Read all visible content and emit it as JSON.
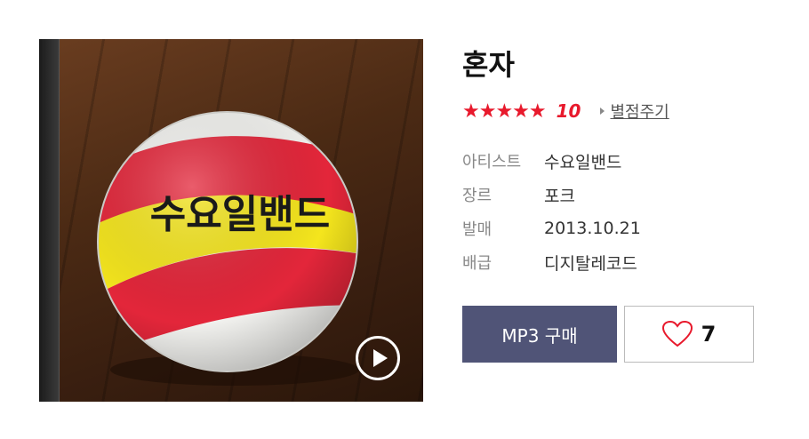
{
  "album": {
    "title": "혼자",
    "cover_text": "수요일밴드"
  },
  "rating": {
    "stars": "★★★★★",
    "score": "10",
    "rate_link": "별점주기"
  },
  "info": [
    {
      "label": "아티스트",
      "value": "수요일밴드"
    },
    {
      "label": "장르",
      "value": "포크"
    },
    {
      "label": "발매",
      "value": "2013.10.21"
    },
    {
      "label": "배급",
      "value": "디지탈레코드"
    }
  ],
  "actions": {
    "buy_label": "MP3 구매",
    "like_count": "7"
  },
  "colors": {
    "star": "#e8192c",
    "buy_button_bg": "#505477"
  },
  "icons": {
    "play": "play-icon",
    "like": "heart-icon"
  }
}
